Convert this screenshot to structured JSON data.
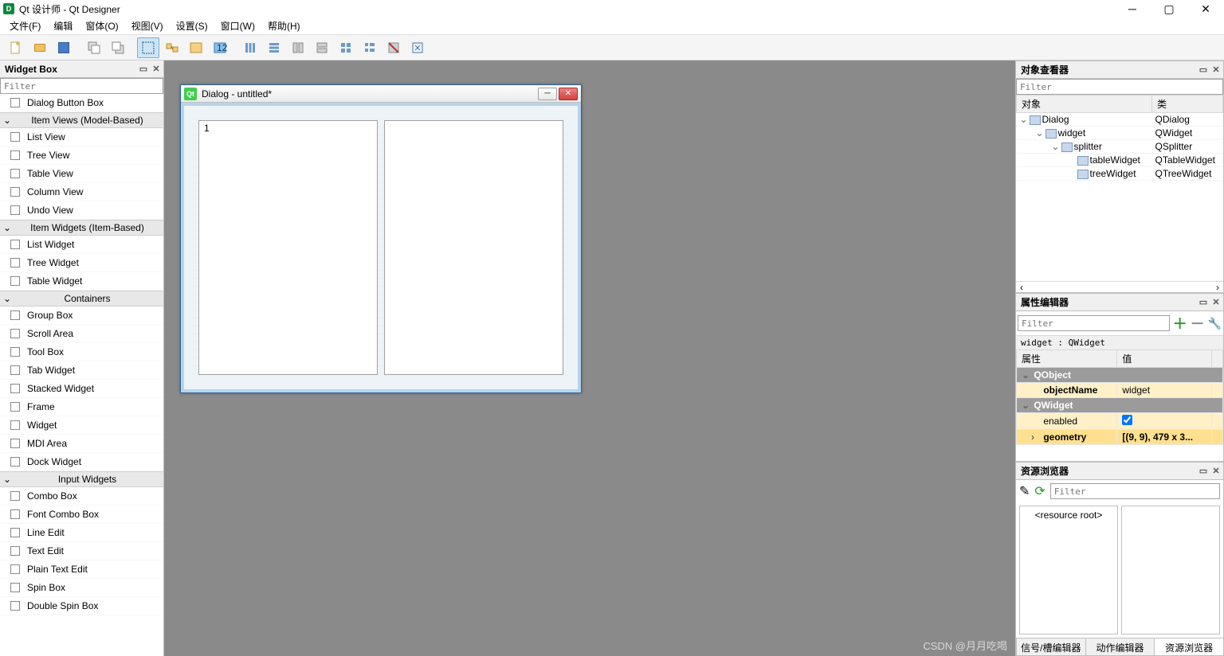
{
  "app": {
    "title": "Qt 设计师 - Qt Designer"
  },
  "menus": [
    "文件(F)",
    "编辑",
    "窗体(O)",
    "视图(V)",
    "设置(S)",
    "窗口(W)",
    "帮助(H)"
  ],
  "widgetBox": {
    "title": "Widget Box",
    "filterPlaceholder": "Filter",
    "groups": [
      {
        "kind": "item",
        "label": "Dialog Button Box"
      },
      {
        "kind": "cat",
        "label": "Item Views (Model-Based)"
      },
      {
        "kind": "item",
        "label": "List View"
      },
      {
        "kind": "item",
        "label": "Tree View"
      },
      {
        "kind": "item",
        "label": "Table View"
      },
      {
        "kind": "item",
        "label": "Column View"
      },
      {
        "kind": "item",
        "label": "Undo View"
      },
      {
        "kind": "cat",
        "label": "Item Widgets (Item-Based)"
      },
      {
        "kind": "item",
        "label": "List Widget"
      },
      {
        "kind": "item",
        "label": "Tree Widget"
      },
      {
        "kind": "item",
        "label": "Table Widget"
      },
      {
        "kind": "cat",
        "label": "Containers"
      },
      {
        "kind": "item",
        "label": "Group Box"
      },
      {
        "kind": "item",
        "label": "Scroll Area"
      },
      {
        "kind": "item",
        "label": "Tool Box"
      },
      {
        "kind": "item",
        "label": "Tab Widget"
      },
      {
        "kind": "item",
        "label": "Stacked Widget"
      },
      {
        "kind": "item",
        "label": "Frame"
      },
      {
        "kind": "item",
        "label": "Widget"
      },
      {
        "kind": "item",
        "label": "MDI Area"
      },
      {
        "kind": "item",
        "label": "Dock Widget"
      },
      {
        "kind": "cat",
        "label": "Input Widgets"
      },
      {
        "kind": "item",
        "label": "Combo Box"
      },
      {
        "kind": "item",
        "label": "Font Combo Box"
      },
      {
        "kind": "item",
        "label": "Line Edit"
      },
      {
        "kind": "item",
        "label": "Text Edit"
      },
      {
        "kind": "item",
        "label": "Plain Text Edit"
      },
      {
        "kind": "item",
        "label": "Spin Box"
      },
      {
        "kind": "item",
        "label": "Double Spin Box"
      }
    ]
  },
  "form": {
    "title": "Dialog - untitled*",
    "tableCell": "1"
  },
  "objectInspector": {
    "title": "对象查看器",
    "filterPlaceholder": "Filter",
    "headers": [
      "对象",
      "类"
    ],
    "rows": [
      {
        "indent": 0,
        "chev": "v",
        "name": "Dialog",
        "class": "QDialog"
      },
      {
        "indent": 1,
        "chev": "v",
        "name": "widget",
        "class": "QWidget"
      },
      {
        "indent": 2,
        "chev": "v",
        "name": "splitter",
        "class": "QSplitter"
      },
      {
        "indent": 3,
        "chev": "",
        "name": "tableWidget",
        "class": "QTableWidget"
      },
      {
        "indent": 3,
        "chev": "",
        "name": "treeWidget",
        "class": "QTreeWidget"
      }
    ]
  },
  "propertyEditor": {
    "title": "属性编辑器",
    "filterPlaceholder": "Filter",
    "context": "widget : QWidget",
    "headers": [
      "属性",
      "值"
    ],
    "rows": [
      {
        "type": "group",
        "label": "QObject"
      },
      {
        "type": "prop",
        "name": "objectName",
        "value": "widget",
        "hl": true,
        "bold": true
      },
      {
        "type": "group",
        "label": "QWidget"
      },
      {
        "type": "prop",
        "name": "enabled",
        "value": "",
        "checkbox": true,
        "hl": true
      },
      {
        "type": "prop",
        "name": "geometry",
        "value": "[(9, 9), 479 x 3...",
        "sel": true,
        "expand": true
      }
    ]
  },
  "resourceBrowser": {
    "title": "资源浏览器",
    "filterPlaceholder": "Filter",
    "root": "<resource root>"
  },
  "bottomTabs": [
    "信号/槽编辑器",
    "动作编辑器",
    "资源浏览器"
  ],
  "watermark": "CSDN @月月吃喝"
}
